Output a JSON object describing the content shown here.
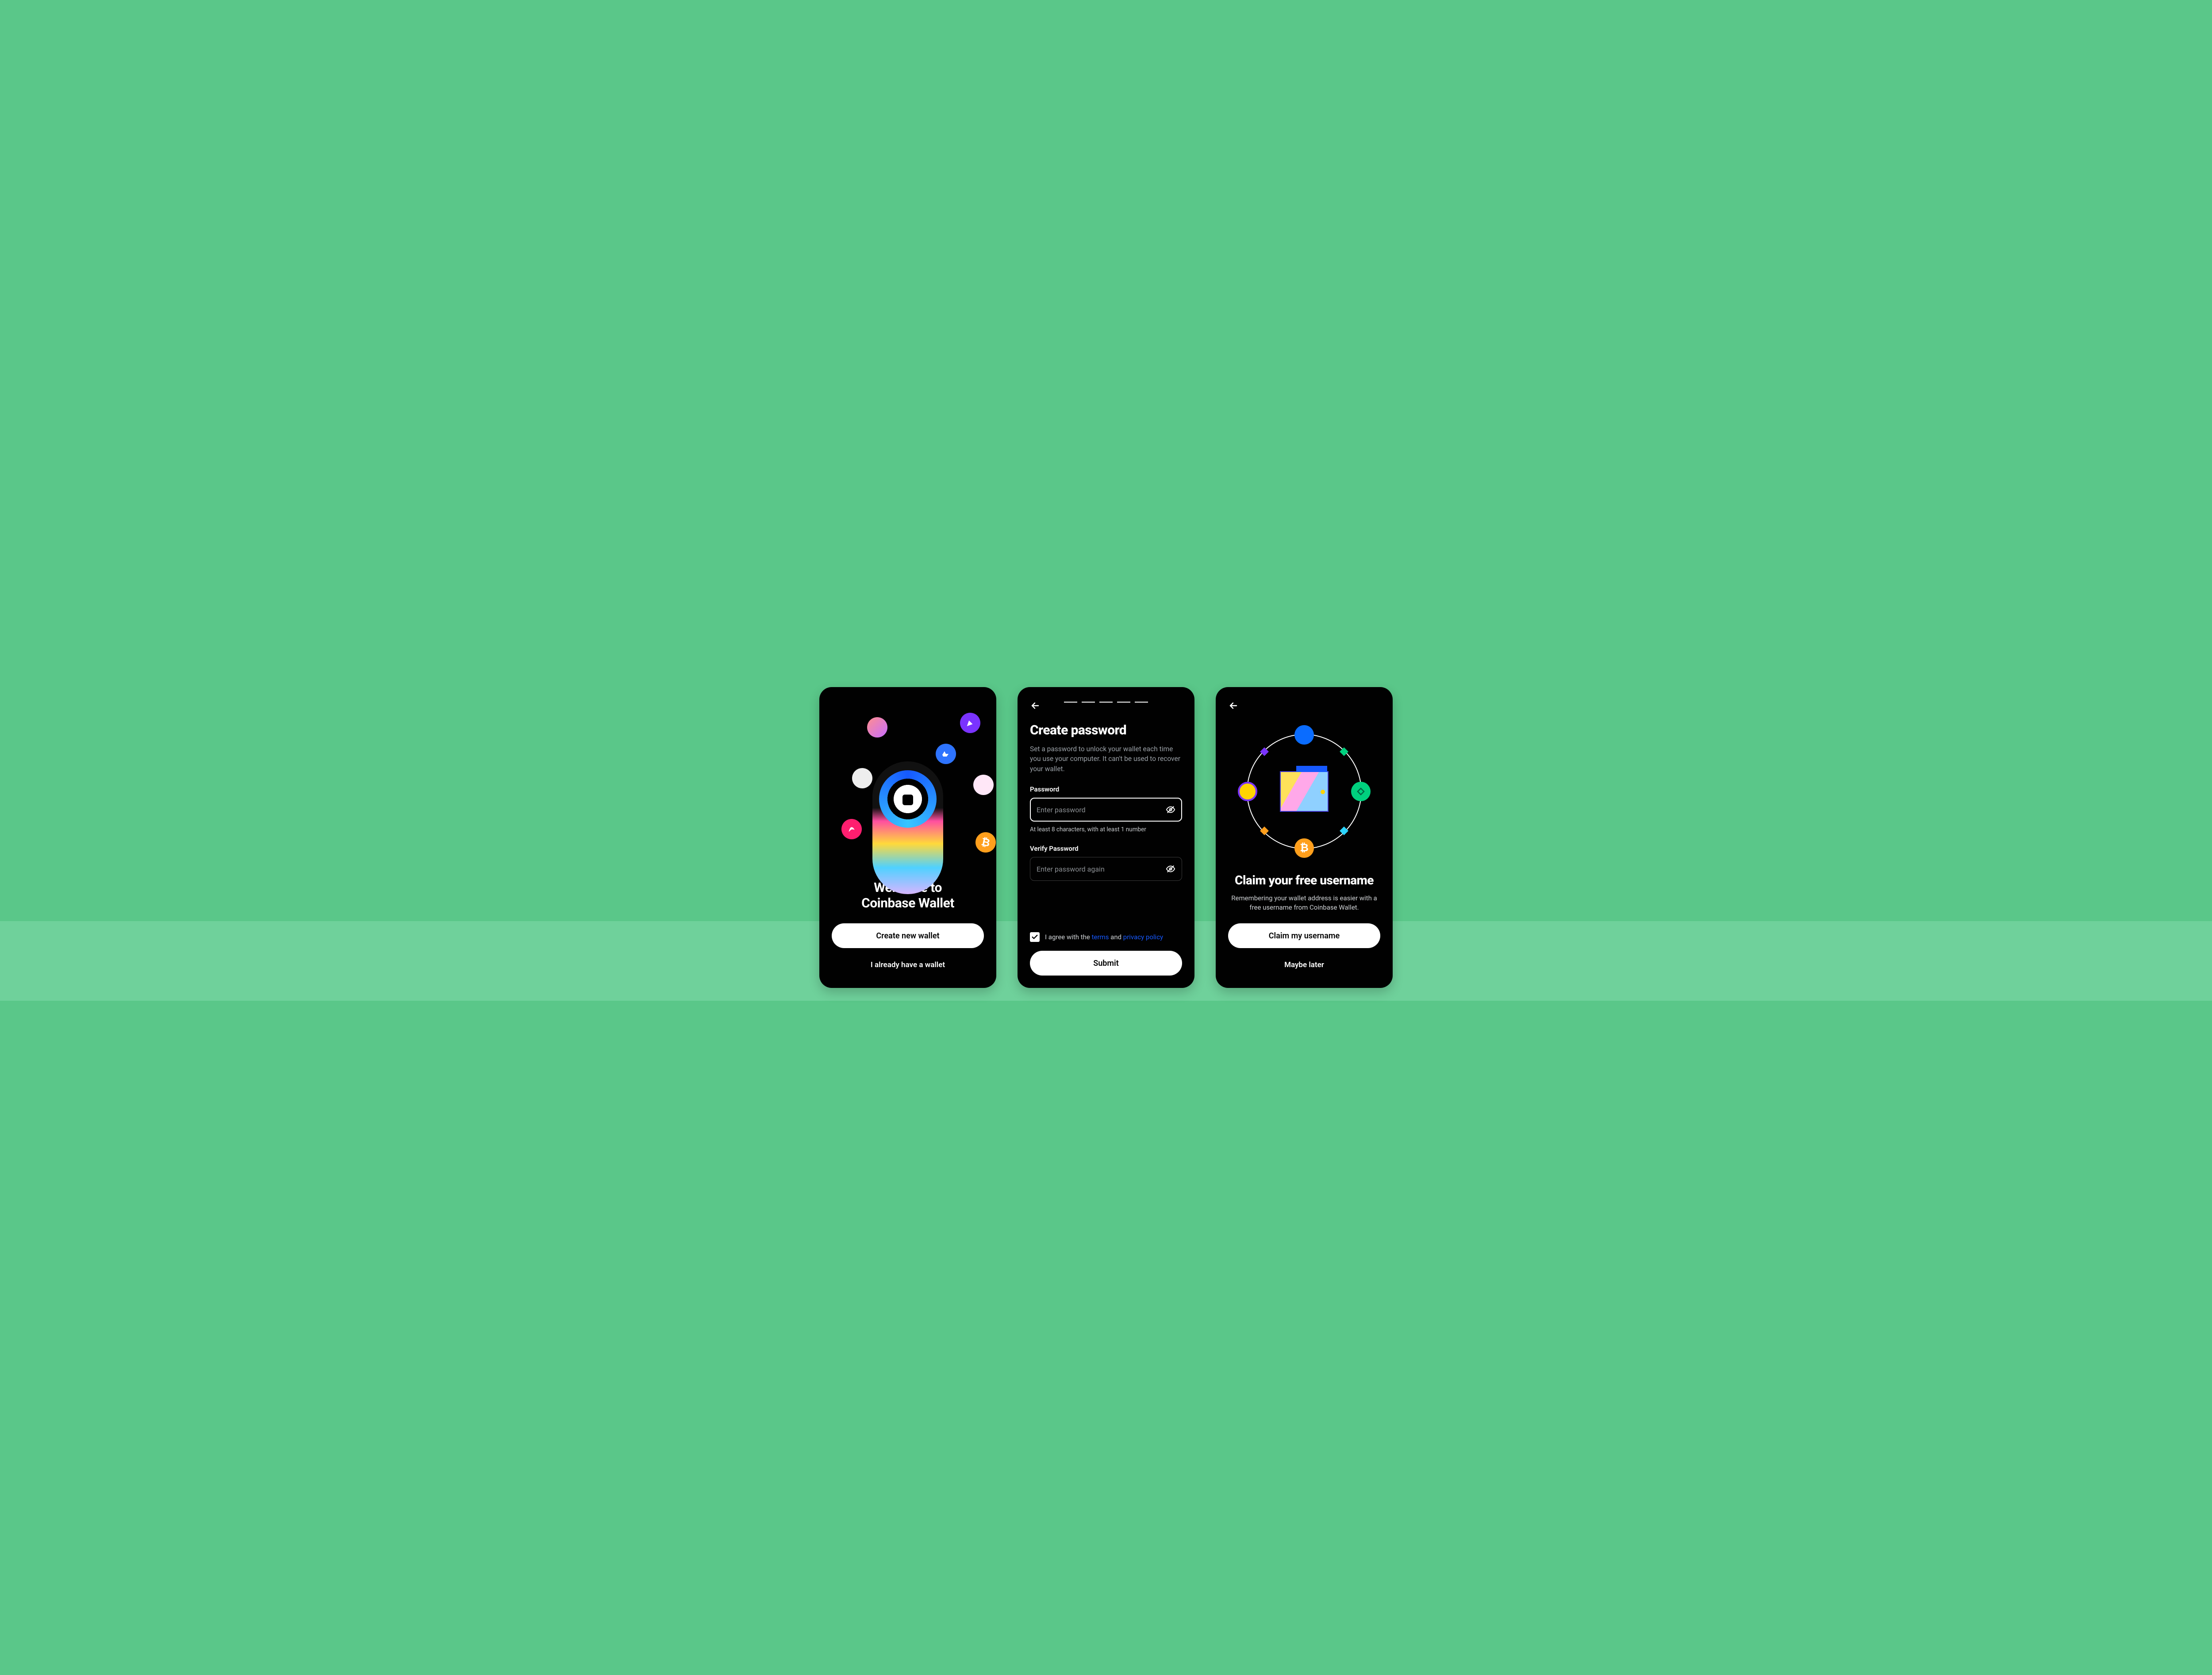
{
  "colors": {
    "accent_blue": "#1659ff",
    "page_bg": "#5ac789",
    "card_bg": "#010101"
  },
  "welcome": {
    "title_line1": "Welcome to",
    "title_line2": "Coinbase Wallet",
    "create_btn": "Create new wallet",
    "existing_btn": "I already have a wallet",
    "tokens": [
      {
        "name": "avatar-1"
      },
      {
        "name": "party-popper-icon"
      },
      {
        "name": "opensea-icon"
      },
      {
        "name": "ape-avatar"
      },
      {
        "name": "nft-avatar"
      },
      {
        "name": "uniswap-icon"
      },
      {
        "name": "bitcoin-icon"
      }
    ]
  },
  "password": {
    "progress_total": 5,
    "heading": "Create password",
    "description": "Set a password to unlock your wallet each time you use your computer. It can't be used to recover your wallet.",
    "pwd_label": "Password",
    "pwd_placeholder": "Enter password",
    "pwd_hint": "At least 8 characters, with at least 1 number",
    "verify_label": "Verify Password",
    "verify_placeholder": "Enter password again",
    "agree_prefix": "I agree with the ",
    "terms": "terms",
    "agree_mid": " and ",
    "privacy": "privacy policy",
    "agree_checked": true,
    "submit": "Submit"
  },
  "username": {
    "heading": "Claim your free username",
    "description": "Remembering your wallet address is easier with a free username from Coinbase Wallet.",
    "claim_btn": "Claim my username",
    "later_btn": "Maybe later",
    "nodes": {
      "bottom_symbol": "₿"
    }
  }
}
